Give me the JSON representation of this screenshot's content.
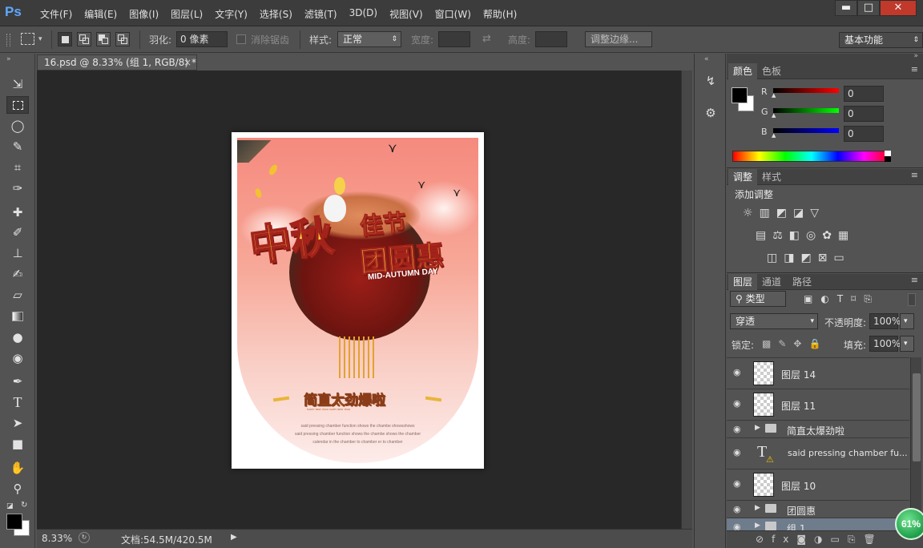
{
  "menubar": {
    "logo": "Ps",
    "items": [
      "文件(F)",
      "编辑(E)",
      "图像(I)",
      "图层(L)",
      "文字(Y)",
      "选择(S)",
      "滤镜(T)",
      "3D(D)",
      "视图(V)",
      "窗口(W)",
      "帮助(H)"
    ],
    "window_controls": {
      "minimize": "▬",
      "maximize": "□",
      "close": "✕"
    }
  },
  "options": {
    "feather_label": "羽化:",
    "feather_value": "0 像素",
    "antialias_label": "消除锯齿",
    "style_label": "样式:",
    "style_value": "正常",
    "width_label": "宽度:",
    "height_label": "高度:",
    "refine_edge": "调整边缘...",
    "workspace": "基本功能"
  },
  "document": {
    "tab_title": "16.psd @ 8.33% (组 1, RGB/8) *",
    "tab_close": "×",
    "zoom": "8.33%",
    "doc_size": "文档:54.5M/420.5M"
  },
  "artwork": {
    "main_title_1": "中秋",
    "main_title_2": "佳节",
    "main_title_3": "团圆惠",
    "subtitle_en": "MID-AUTUMN DAY",
    "tagline": "简直太劲爆啦",
    "tagline_small": "HAPPY NEW YEAR HAPPY NEW YEAR",
    "body_lines": [
      "said pressing chamber function shows the chambe showsshows",
      "said pressing chamber function shows the chambe shows the chamber",
      "calendar in the chamber to chamber er to chamber"
    ]
  },
  "color_panel": {
    "tabs": [
      "颜色",
      "色板"
    ],
    "r_label": "R",
    "r_value": "0",
    "g_label": "G",
    "g_value": "0",
    "b_label": "B",
    "b_value": "0",
    "foreground": "#000000",
    "background": "#ffffff"
  },
  "adjustments_panel": {
    "tabs": [
      "调整",
      "样式"
    ],
    "heading": "添加调整"
  },
  "layers_panel": {
    "tabs": [
      "图层",
      "通道",
      "路径"
    ],
    "filter_kind": "类型",
    "blend_mode": "穿透",
    "opacity_label": "不透明度:",
    "opacity_value": "100%",
    "lock_label": "锁定:",
    "fill_label": "填充:",
    "fill_value": "100%",
    "layers": [
      {
        "name": "图层 14",
        "kind": "pixel"
      },
      {
        "name": "图层 11",
        "kind": "pixel"
      },
      {
        "name": "简直太爆劲啦",
        "kind": "group"
      },
      {
        "name": "said pressing chamber fu...",
        "kind": "text"
      },
      {
        "name": "图层 10",
        "kind": "pixel"
      },
      {
        "name": "团圆惠",
        "kind": "group"
      },
      {
        "name": "组 1",
        "kind": "group"
      }
    ],
    "progress_badge": "61%"
  }
}
